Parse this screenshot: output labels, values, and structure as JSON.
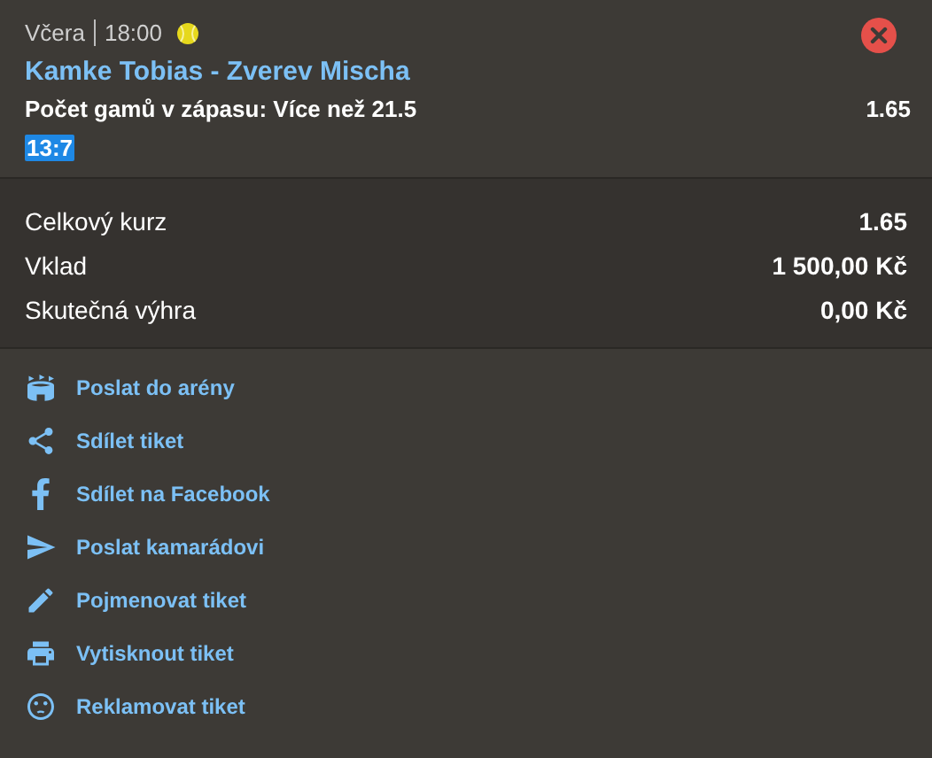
{
  "bet": {
    "day": "Včera",
    "time": "18:00",
    "match": "Kamke Tobias - Zverev Mischa",
    "market": "Počet gamů v zápasu: **Více než 21.5**",
    "odds": "1.65",
    "score": "13:7"
  },
  "summary": [
    {
      "label": "Celkový kurz",
      "value": "1.65"
    },
    {
      "label": "Vklad",
      "value": "1 500,00 Kč"
    },
    {
      "label": "Skutečná výhra",
      "value": "0,00 Kč"
    }
  ],
  "actions": [
    {
      "kind": "arena",
      "label": "Poslat do arény"
    },
    {
      "kind": "share",
      "label": "Sdílet tiket"
    },
    {
      "kind": "facebook",
      "label": "Sdílet na Facebook"
    },
    {
      "kind": "send",
      "label": "Poslat kamarádovi"
    },
    {
      "kind": "edit",
      "label": "Pojmenovat tiket"
    },
    {
      "kind": "print",
      "label": "Vytisknout tiket"
    },
    {
      "kind": "complain",
      "label": "Reklamovat tiket"
    }
  ]
}
